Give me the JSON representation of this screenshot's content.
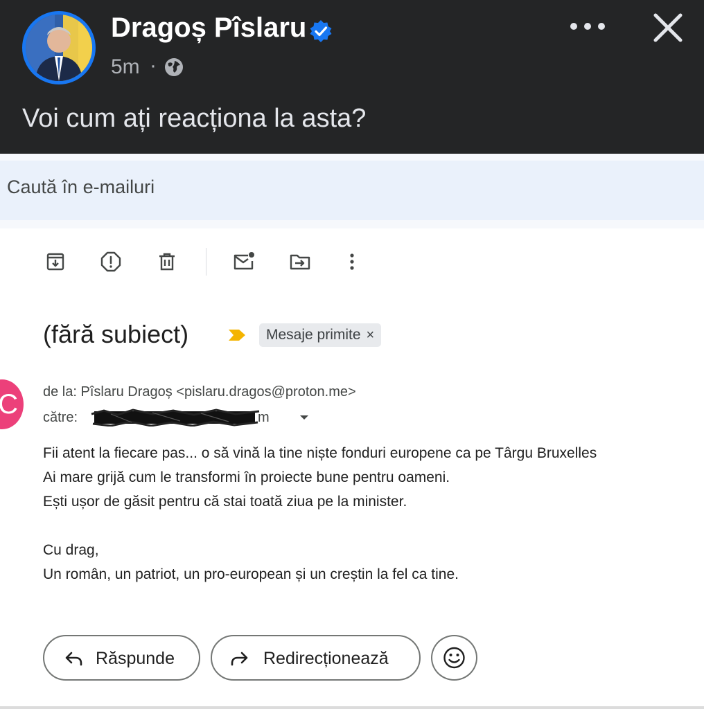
{
  "post": {
    "author": "Dragoș Pîslaru",
    "time": "5m",
    "separator": "·",
    "text": "Voi cum ați reacționa la asta?",
    "icons": {
      "verified": "verified-badge-icon",
      "privacy": "globe-icon",
      "more": "more-horizontal-icon",
      "close": "close-icon"
    }
  },
  "gmail": {
    "search": {
      "placeholder": "Caută în e-mailuri"
    },
    "toolbar": [
      "archive-icon",
      "report-spam-icon",
      "delete-icon",
      "mark-unread-icon",
      "move-to-icon",
      "more-vertical-icon"
    ],
    "subject": "(fără subiect)",
    "label": "Mesaje primite",
    "label_remove": "×",
    "sender_initial": "C",
    "from_line": "de la: Pîslaru Dragoș <pislaru.dragos@proton.me>",
    "to_label": "către:",
    "to_tail": "m",
    "body": [
      "Fii atent la fiecare pas... o să vină la tine niște fonduri europene ca pe Târgu Bruxelles",
      "Ai mare grijă cum le transformi în proiecte bune pentru oameni.",
      "Ești ușor de găsit pentru că stai toată ziua pe la minister.",
      "",
      "Cu drag,",
      "Un român, un patriot, un pro-european și un creștin la fel ca tine."
    ],
    "actions": {
      "reply": "Răspunde",
      "forward": "Redirecționează"
    }
  },
  "colors": {
    "fb_background": "#242526",
    "fb_accent": "#1877f2",
    "search_bar": "#eaf1fb",
    "important_marker": "#f4b400",
    "sender_avatar": "#ec407a"
  }
}
